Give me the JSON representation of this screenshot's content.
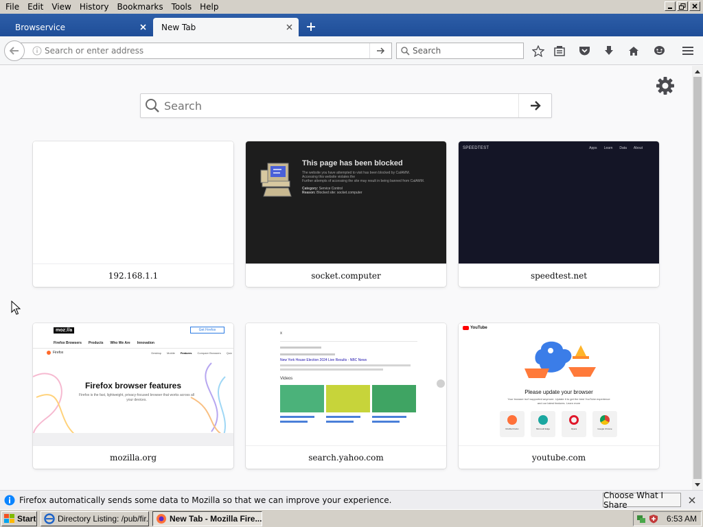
{
  "menu": [
    "File",
    "Edit",
    "View",
    "History",
    "Bookmarks",
    "Tools",
    "Help"
  ],
  "tabs": [
    {
      "label": "Browservice"
    },
    {
      "label": "New Tab"
    }
  ],
  "nav": {
    "url_placeholder": "Search or enter address",
    "search_placeholder": "Search"
  },
  "page_search": {
    "placeholder": "Search"
  },
  "tiles": [
    {
      "title": "192.168.1.1",
      "preview": {}
    },
    {
      "title": "socket.computer",
      "preview": {
        "heading": "This page has been blocked",
        "lines": [
          "The website you have attempted to visit has been blocked by CalAMM.",
          "Accessing this website violates the",
          "Further attempts of accessing the site may result in being banned from CalAMM."
        ],
        "category_label": "Category:",
        "category_value": "Service Control",
        "reason_label": "Reason:",
        "reason_value": "Blocked site: socket.computer"
      }
    },
    {
      "title": "speedtest.net",
      "preview": {
        "logo": "SPEEDTEST",
        "nav": [
          "Apps",
          "Learn",
          "Data",
          "About"
        ]
      }
    },
    {
      "title": "mozilla.org",
      "preview": {
        "logo": "moz://a",
        "cta": "Get Firefox",
        "nav": [
          "Firefox Browsers",
          "Products",
          "Who We Are",
          "Innovation"
        ],
        "sub_brand": "Firefox",
        "subnav": [
          "Desktop",
          "Mobile",
          "Features",
          "Compare Browsers",
          "Quiz"
        ],
        "heading": "Firefox browser features",
        "lines": [
          "Firefox is the fast, lightweight, privacy-focused browser that works across all",
          "your devices."
        ]
      }
    },
    {
      "title": "search.yahoo.com",
      "preview": {
        "query": "x",
        "result_title": "New York House Election 2024 Live Results - NBC News",
        "section": "Videos"
      }
    },
    {
      "title": "youtube.com",
      "preview": {
        "logo": "YouTube",
        "heading": "Please update your browser",
        "lines": [
          "Your browser isn't supported anymore. Update it to get the best YouTube experience",
          "and our latest features. Learn more"
        ],
        "browsers": [
          "Mozilla Firefox",
          "Microsoft Edge",
          "Opera",
          "Google Chrome"
        ]
      }
    }
  ],
  "notification": {
    "text": "Firefox automatically sends some data to Mozilla so that we can improve your experience.",
    "button": "Choose What I Share"
  },
  "taskbar": {
    "start": "Start",
    "tasks": [
      "Directory Listing: /pub/fir...",
      "New Tab - Mozilla Fire..."
    ],
    "time": "6:53 AM"
  },
  "colors": {
    "tab_strip": "#1f4e98",
    "toolbar": "#f5f6f7",
    "content_bg": "#f9f9fa",
    "blocked_bg": "#1d1d1d",
    "speedtest_bg": "#141526"
  }
}
